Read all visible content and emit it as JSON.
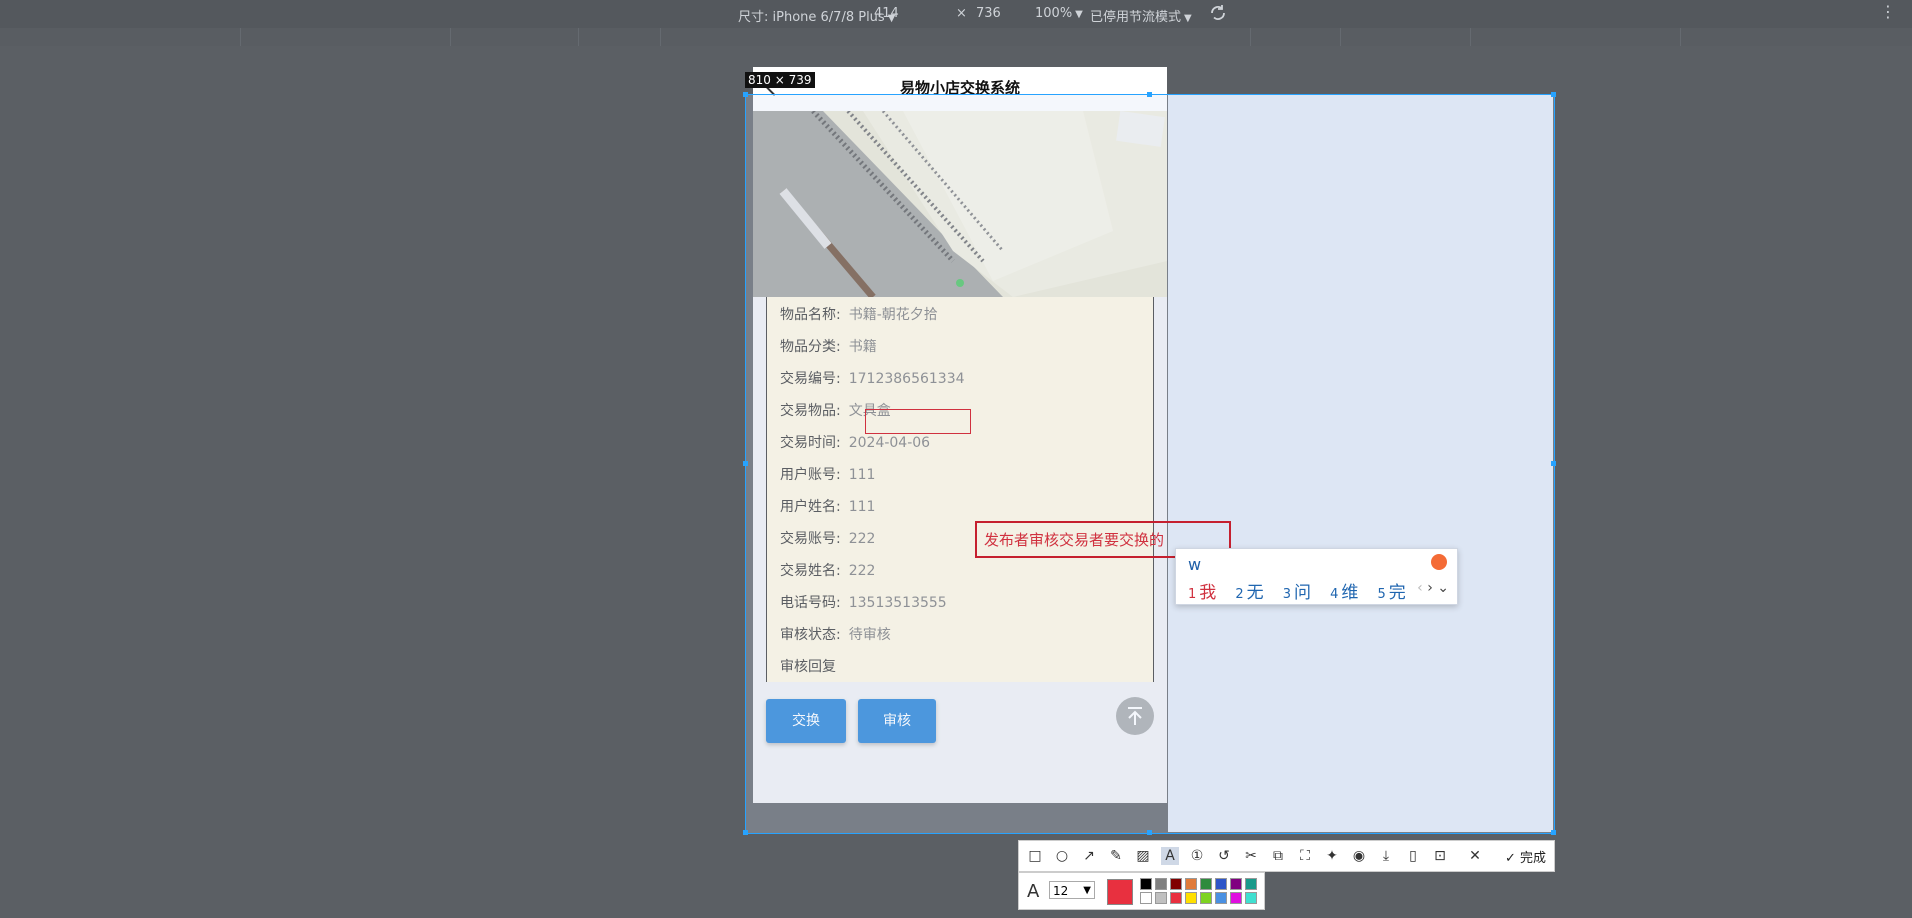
{
  "devtools": {
    "device_label": "尺寸: iPhone 6/7/8 Plus",
    "width": "414",
    "times": "×",
    "height": "736",
    "zoom": "100%",
    "throttle": "已停用节流模式"
  },
  "selection": {
    "size_label": "810 × 739"
  },
  "app": {
    "title": "易物小店交换系统",
    "details": [
      {
        "label": "物品名称:",
        "value": "书籍-朝花夕拾"
      },
      {
        "label": "物品分类:",
        "value": "书籍"
      },
      {
        "label": "交易编号:",
        "value": "1712386561334"
      },
      {
        "label": "交易物品:",
        "value": "文具盒"
      },
      {
        "label": "交易时间:",
        "value": "2024-04-06"
      },
      {
        "label": "用户账号:",
        "value": "111"
      },
      {
        "label": "用户姓名:",
        "value": "111"
      },
      {
        "label": "交易账号:",
        "value": "222"
      },
      {
        "label": "交易姓名:",
        "value": "222"
      },
      {
        "label": "电话号码:",
        "value": "13513513555"
      },
      {
        "label": "审核状态:",
        "value": "待审核"
      },
      {
        "label": "审核回复",
        "value": ""
      }
    ],
    "buttons": {
      "exchange": "交换",
      "audit": "审核"
    }
  },
  "annotation": {
    "text": "发布者审核交易者要交换的"
  },
  "ime": {
    "input": "w",
    "candidates": [
      {
        "num": "1",
        "word": "我"
      },
      {
        "num": "2",
        "word": "无"
      },
      {
        "num": "3",
        "word": "问"
      },
      {
        "num": "4",
        "word": "维"
      },
      {
        "num": "5",
        "word": "完"
      }
    ]
  },
  "toolbar": {
    "done_label": "完成",
    "font_size": "12"
  },
  "colors": {
    "selected": "#e8303f",
    "palette_top": [
      "#000000",
      "#808080",
      "#800000",
      "#e07b39",
      "#2e8b3d",
      "#2e55c8",
      "#800080",
      "#1a9a8a"
    ],
    "palette_bottom": [
      "#ffffff",
      "#c0c0c0",
      "#e8303f",
      "#ffe000",
      "#7ed321",
      "#4a90e2",
      "#e010e0",
      "#40e0d0"
    ]
  }
}
